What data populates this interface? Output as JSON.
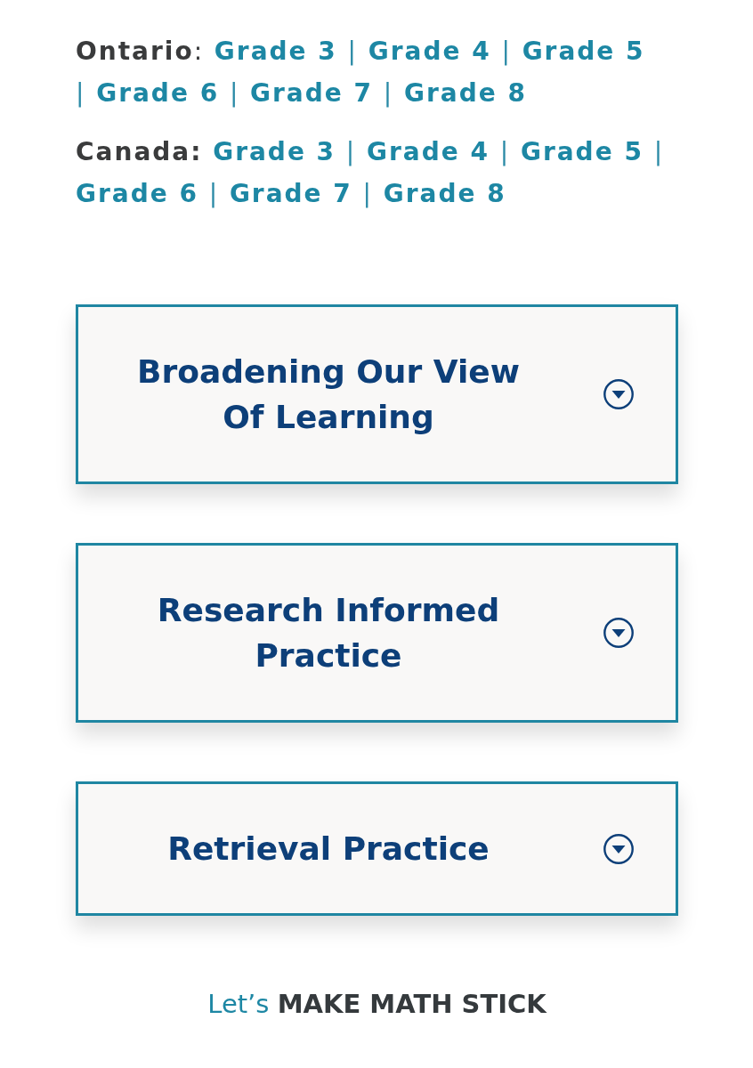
{
  "regions": [
    {
      "label": "**Ontario**:",
      "lines": [
        [
          {
            "kind": "link",
            "text": "Grade 3"
          },
          {
            "kind": "separator",
            "text": "|"
          },
          {
            "kind": "link",
            "text": "Grade 4"
          },
          {
            "kind": "separator",
            "text": "|"
          },
          {
            "kind": "link",
            "text": "Grade 5"
          }
        ],
        [
          {
            "kind": "separator",
            "text": "|"
          },
          {
            "kind": "link",
            "text": "Grade 6"
          },
          {
            "kind": "separator",
            "text": "|"
          },
          {
            "kind": "link",
            "text": "Grade 7"
          },
          {
            "kind": "separator",
            "text": "|"
          },
          {
            "kind": "link",
            "text": "Grade 8"
          }
        ]
      ]
    },
    {
      "label": "**Canada:**",
      "lines": [
        [
          {
            "kind": "link",
            "text": "Grade 3"
          },
          {
            "kind": "separator",
            "text": "|"
          },
          {
            "kind": "link",
            "text": "Grade 4"
          },
          {
            "kind": "separator",
            "text": "|"
          },
          {
            "kind": "link",
            "text": "Grade 5"
          },
          {
            "kind": "separator",
            "text": "|"
          }
        ],
        [
          {
            "kind": "link",
            "text": "Grade 6"
          },
          {
            "kind": "separator",
            "text": "|"
          },
          {
            "kind": "link",
            "text": "Grade 7"
          },
          {
            "kind": "separator",
            "text": "|"
          },
          {
            "kind": "link",
            "text": "Grade 8"
          }
        ]
      ]
    }
  ],
  "sections": [
    {
      "title": "Broadening Our View Of Learning",
      "expanded": false
    },
    {
      "title": "Research Informed Practice",
      "expanded": false
    },
    {
      "title": "Retrieval Practice",
      "expanded": false
    }
  ],
  "tagline": "Let’s **MAKE MATH STICK**"
}
